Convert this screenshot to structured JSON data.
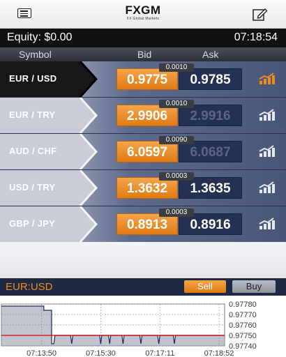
{
  "header": {
    "logo_main": "FXGM",
    "logo_sub": "FX Global Markets",
    "menu_icon": "hamburger-icon",
    "edit_icon": "pencil-square-icon"
  },
  "status": {
    "equity": "Equity: $0.00",
    "time": "07:18:54"
  },
  "columns": {
    "symbol": "Symbol",
    "bid": "Bid",
    "ask": "Ask"
  },
  "rows": [
    {
      "symbol": "EUR / USD",
      "spread": "0.0010",
      "bid": "0.9775",
      "ask": "0.9785",
      "selected": true
    },
    {
      "symbol": "EUR / TRY",
      "spread": "0.0010",
      "bid": "2.9906",
      "ask": "2.9916",
      "selected": false
    },
    {
      "symbol": "AUD / CHF",
      "spread": "0.0090",
      "bid": "6.0597",
      "ask": "6.0687",
      "selected": false
    },
    {
      "symbol": "USD / TRY",
      "spread": "0.0003",
      "bid": "1.3632",
      "ask": "1.3635",
      "selected": false
    },
    {
      "symbol": "GBP / JPY",
      "spread": "0.0003",
      "bid": "0.8913",
      "ask": "0.8916",
      "selected": false
    }
  ],
  "trade_bar": {
    "pair": "EUR:USD",
    "sell": "Sell",
    "buy": "Buy"
  },
  "chart_data": {
    "type": "line",
    "x_labels": [
      "07:13:50",
      "07:15:30",
      "07:17:11",
      "07:18:52"
    ],
    "y_labels": [
      "0.97780",
      "0.97770",
      "0.97760",
      "0.97750",
      "0.97740"
    ],
    "current_value": "0.97750",
    "ylim": [
      0.9774,
      0.9778
    ],
    "series": [
      {
        "points": [
          [
            0,
            0.97778
          ],
          [
            0.19,
            0.97778
          ],
          [
            0.19,
            0.97774
          ],
          [
            0.225,
            0.97774
          ],
          [
            0.225,
            0.97742
          ],
          [
            0.235,
            0.97742
          ],
          [
            0.24,
            0.9775
          ],
          [
            0.31,
            0.9775
          ],
          [
            0.315,
            0.97742
          ],
          [
            0.32,
            0.9775
          ],
          [
            0.44,
            0.9775
          ],
          [
            0.445,
            0.97742
          ],
          [
            0.45,
            0.9775
          ],
          [
            0.48,
            0.9775
          ],
          [
            0.485,
            0.97742
          ],
          [
            0.49,
            0.9775
          ],
          [
            0.54,
            0.9775
          ],
          [
            0.545,
            0.97742
          ],
          [
            0.55,
            0.9775
          ],
          [
            0.62,
            0.9775
          ],
          [
            0.625,
            0.97742
          ],
          [
            0.63,
            0.9775
          ],
          [
            0.7,
            0.9775
          ],
          [
            0.705,
            0.97742
          ],
          [
            0.71,
            0.9775
          ],
          [
            0.77,
            0.9775
          ],
          [
            0.775,
            0.97742
          ],
          [
            0.78,
            0.9775
          ],
          [
            1.0,
            0.9775
          ]
        ]
      }
    ],
    "colors": {
      "line": "#1d2a55",
      "fill": "#8a93a8",
      "current": "#e00000"
    }
  }
}
